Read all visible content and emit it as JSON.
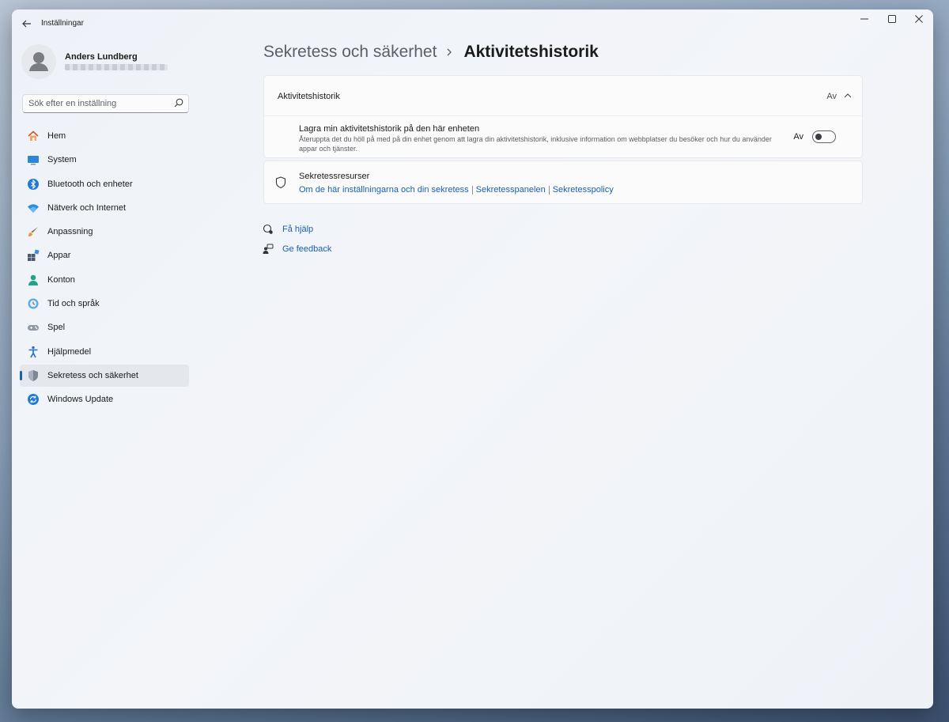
{
  "window": {
    "app_title": "Inställningar"
  },
  "profile": {
    "name": "Anders Lundberg"
  },
  "search": {
    "placeholder": "Sök efter en inställning"
  },
  "sidebar": {
    "items": [
      {
        "label": "Hem",
        "icon": "home-icon"
      },
      {
        "label": "System",
        "icon": "monitor-icon"
      },
      {
        "label": "Bluetooth och enheter",
        "icon": "bluetooth-icon"
      },
      {
        "label": "Nätverk och Internet",
        "icon": "wifi-icon"
      },
      {
        "label": "Anpassning",
        "icon": "paintbrush-icon"
      },
      {
        "label": "Appar",
        "icon": "apps-icon"
      },
      {
        "label": "Konton",
        "icon": "account-icon"
      },
      {
        "label": "Tid och språk",
        "icon": "globe-clock-icon"
      },
      {
        "label": "Spel",
        "icon": "gamepad-icon"
      },
      {
        "label": "Hjälpmedel",
        "icon": "accessibility-icon"
      },
      {
        "label": "Sekretess och säkerhet",
        "icon": "shield-icon",
        "active": true
      },
      {
        "label": "Windows Update",
        "icon": "update-icon"
      }
    ]
  },
  "breadcrumb": {
    "parent": "Sekretess och säkerhet",
    "current": "Aktivitetshistorik"
  },
  "activity_card": {
    "title": "Aktivitetshistorik",
    "state": "Av",
    "setting_title": "Lagra min aktivitetshistorik på den här enheten",
    "setting_desc": "Återuppta det du höll på med på din enhet genom att lagra din aktivitetshistorik, inklusive information om webbplatser du besöker och hur du använder appar och tjänster.",
    "toggle_label": "Av",
    "toggle_on": false
  },
  "resources_card": {
    "title": "Sekretessresurser",
    "links": [
      "Om de här inställningarna och din sekretess",
      "Sekretesspanelen",
      "Sekretesspolicy"
    ]
  },
  "help": {
    "get_help": "Få hjälp",
    "feedback": "Ge feedback"
  },
  "colors": {
    "accent": "#1a5fb4",
    "active_bg": "#e4e7ec"
  }
}
